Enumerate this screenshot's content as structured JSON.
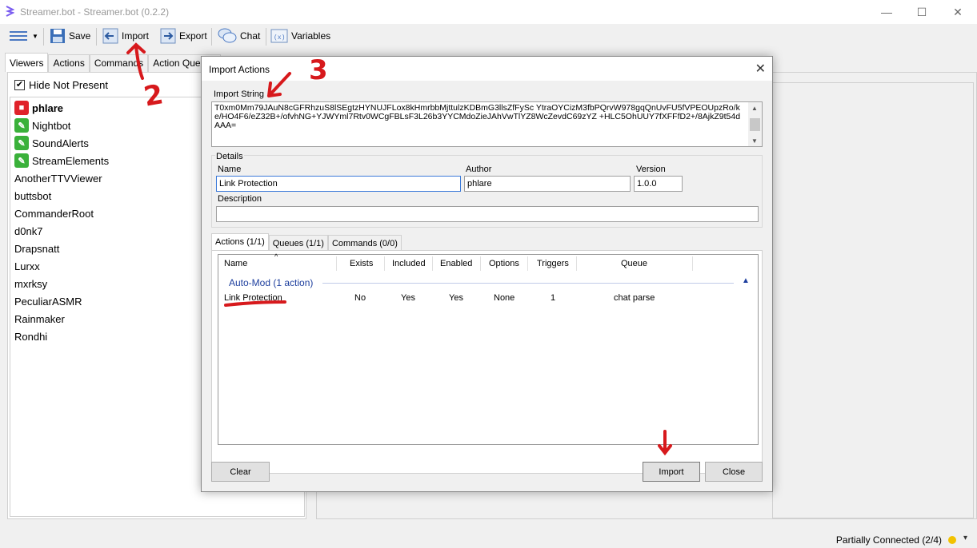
{
  "window": {
    "title": "Streamer.bot - Streamer.bot (0.2.2)",
    "controls": [
      "—",
      "☐",
      "✕"
    ]
  },
  "toolbar": {
    "save_label": "Save",
    "import_label": "Import",
    "export_label": "Export",
    "chat_label": "Chat",
    "variables_label": "Variables"
  },
  "left_panel": {
    "tabs": [
      "Viewers",
      "Actions",
      "Commands",
      "Action Queues"
    ],
    "hide_not_present_label": "Hide Not Present",
    "hide_not_present_checked": true,
    "viewers": [
      {
        "name": "phlare",
        "badge": "camera-icon",
        "bold": true
      },
      {
        "name": "Nightbot",
        "badge": "bot-icon"
      },
      {
        "name": "SoundAlerts",
        "badge": "bot-icon"
      },
      {
        "name": "StreamElements",
        "badge": "bot-icon"
      },
      {
        "name": "AnotherTTVViewer"
      },
      {
        "name": "buttsbot"
      },
      {
        "name": "CommanderRoot"
      },
      {
        "name": "d0nk7"
      },
      {
        "name": "Drapsnatt"
      },
      {
        "name": "Lurxx"
      },
      {
        "name": "mxrksy"
      },
      {
        "name": "PeculiarASMR"
      },
      {
        "name": "Rainmaker"
      },
      {
        "name": "Rondhi"
      }
    ]
  },
  "dialog": {
    "title": "Import Actions",
    "import_string_label": "Import String",
    "import_string_value": "T0xm0Mm79JAuN8cGFRhzuS8lSEgtzHYNUJFLox8kHmrbbMjttulzKDBmG3llsZfFySc YtraOYCizM3fbPQrvW978gqQnUvFU5fVPEOUpzRo/ke/HO4F6/eZ32B+/ofvhNG+YJWYml7Rtv0WCgFBLsF3L26b3YYCMdoZieJAhVwTlYZ8WcZevdC69zYZ +HLC5OhUUY7fXFFfD2+/8AjkZ9t54dAAA=",
    "details_label": "Details",
    "name_label": "Name",
    "name_value": "Link Protection",
    "author_label": "Author",
    "author_value": "phlare",
    "version_label": "Version",
    "version_value": "1.0.0",
    "description_label": "Description",
    "description_value": "",
    "tabs": [
      "Actions (1/1)",
      "Queues (1/1)",
      "Commands (0/0)"
    ],
    "columns": [
      "Name",
      "Exists",
      "Included",
      "Enabled",
      "Options",
      "Triggers",
      "Queue"
    ],
    "group_label": "Auto-Mod (1 action)",
    "rows": [
      {
        "name": "Link Protection",
        "exists": "No",
        "included": "Yes",
        "enabled": "Yes",
        "options": "None",
        "triggers": "1",
        "queue": "chat parse"
      }
    ],
    "clear_label": "Clear",
    "import_label": "Import",
    "close_label": "Close"
  },
  "statusbar": {
    "text": "Partially Connected (2/4)",
    "status_color": "#f2c200"
  },
  "annotations": [
    "2",
    "3"
  ]
}
